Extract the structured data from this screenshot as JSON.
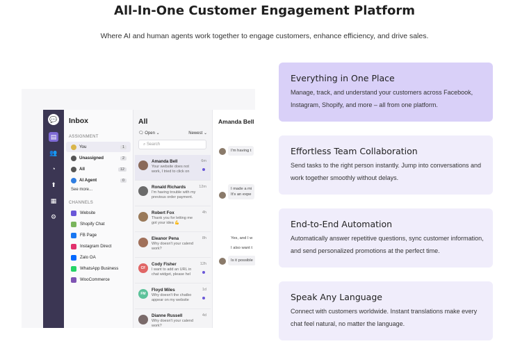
{
  "header": {
    "title": "All-In-One Customer Engagement Platform",
    "subtitle": "Where AI and human agents work together to engage customers, enhance efficiency, and drive sales."
  },
  "mock": {
    "inbox_title": "Inbox",
    "assignment_label": "ASSIGNMENT",
    "assignment": [
      {
        "label": "You",
        "count": "1",
        "color": "#d9b54a"
      },
      {
        "label": "Unassigned",
        "count": "2",
        "color": "#555555"
      },
      {
        "label": "All",
        "count": "12",
        "color": "#555555"
      },
      {
        "label": "AI Agent",
        "count": "0",
        "color": "#2f7de1"
      }
    ],
    "see_more": "See more...",
    "channels_label": "CHANNELS",
    "channels": [
      {
        "label": "Website",
        "color": "#6a57d8"
      },
      {
        "label": "Shopify Chat",
        "color": "#7ab55c"
      },
      {
        "label": "FB Page",
        "color": "#1877f2"
      },
      {
        "label": "Instagram Direct",
        "color": "#e1306c"
      },
      {
        "label": "Zalo OA",
        "color": "#0068ff"
      },
      {
        "label": "WhatsApp Business",
        "color": "#25d366"
      },
      {
        "label": "WooCommerce",
        "color": "#7f54b3"
      }
    ],
    "list_title": "All",
    "filter_open": "Open ⌄",
    "filter_sort": "Newest ⌄",
    "search_placeholder": "Search",
    "conversations": [
      {
        "name": "Amanda Bell",
        "preview": "Your website does not\nwork, I tried to click on",
        "time": "6m",
        "unread": true,
        "avatar_color": "#8a6a5a",
        "initials": ""
      },
      {
        "name": "Ronald Richards",
        "preview": "I'm having trouble with my\nprevious order payment.",
        "time": "12m",
        "unread": false,
        "avatar_color": "#6a6a6a",
        "initials": ""
      },
      {
        "name": "Robert Fox",
        "preview": "Thank you for letting me\ngot your idea 💪",
        "time": "4h",
        "unread": false,
        "avatar_color": "#9a7a5a",
        "initials": ""
      },
      {
        "name": "Eleanor Pena",
        "preview": "Why doesn't your calend\nwork?",
        "time": "8h",
        "unread": false,
        "avatar_color": "#a0705a",
        "initials": ""
      },
      {
        "name": "Cody Fisher",
        "preview": "I want to add an URL in\nchat widget, please hel",
        "time": "12h",
        "unread": true,
        "avatar_color": "#e06666",
        "initials": "CF"
      },
      {
        "name": "Floyd Miles",
        "preview": "Why doesn't the chatbo\nappear on my website",
        "time": "1d",
        "unread": true,
        "avatar_color": "#5cc29a",
        "initials": "FM"
      },
      {
        "name": "Dianne Russell",
        "preview": "Why doesn't your calend\nwork?",
        "time": "4d",
        "unread": false,
        "avatar_color": "#7a6a6a",
        "initials": ""
      }
    ],
    "chat_title": "Amanda Bell",
    "messages": [
      "I'm having t",
      "I made a mi\nIt's an expe",
      "Yes, and I w",
      "I also want t",
      "Is it possible"
    ]
  },
  "features": [
    {
      "title": "Everything in One Place",
      "text": "Manage, track, and understand your customers across Facebook, Instagram, Shopify, and more – all from one platform."
    },
    {
      "title": "Effortless Team Collaboration",
      "text": "Send tasks to the right person instantly. Jump into conversations and work together smoothly without delays."
    },
    {
      "title": "End-to-End Automation",
      "text": "Automatically answer repetitive questions, sync customer information, and send personalized promotions at the perfect time."
    },
    {
      "title": "Speak Any Language",
      "text": "Connect with customers worldwide. Instant translations make every chat feel natural, no matter the language."
    }
  ]
}
